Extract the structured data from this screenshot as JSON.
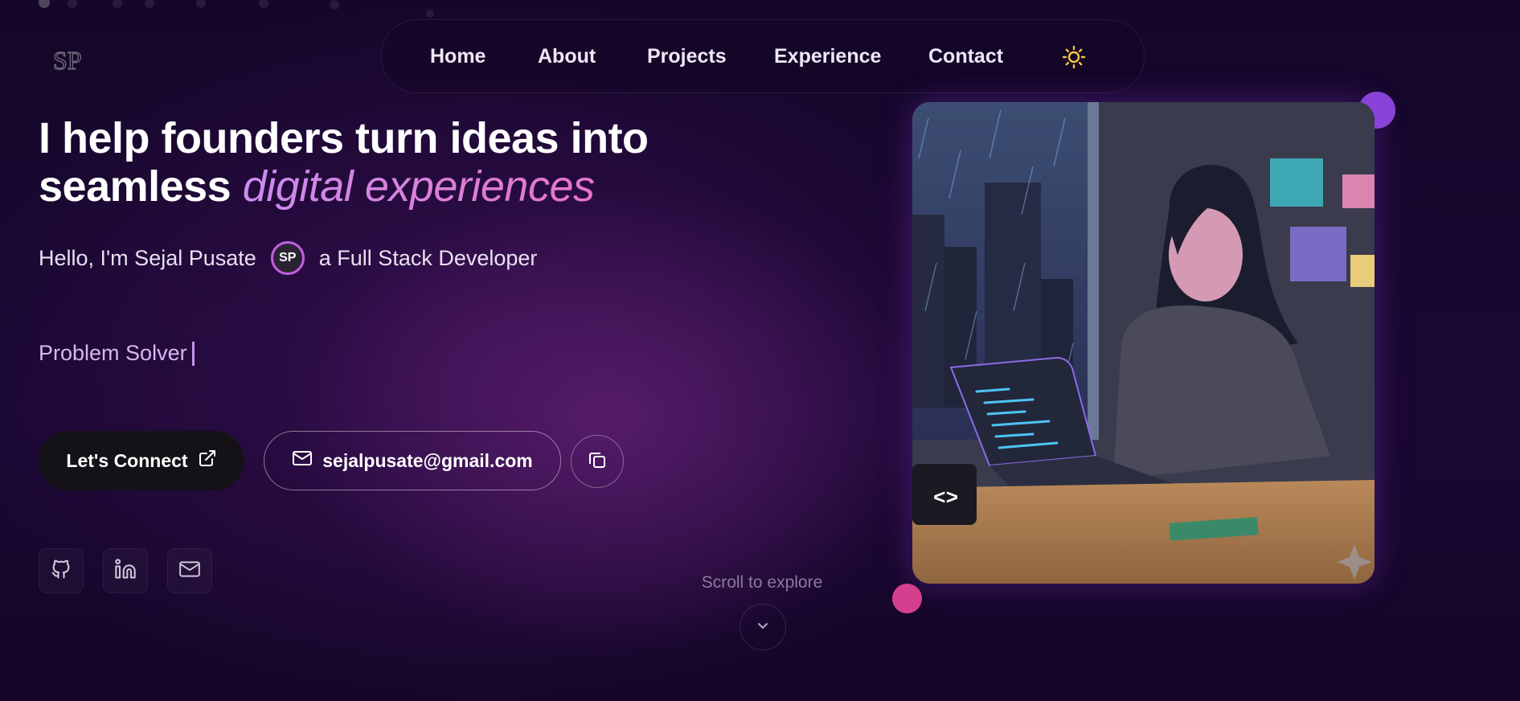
{
  "logo": {
    "text": "SP"
  },
  "nav": {
    "items": [
      "Home",
      "About",
      "Projects",
      "Experience",
      "Contact"
    ],
    "theme_toggle_icon": "sun-icon"
  },
  "hero": {
    "headline_line1": "I help founders turn ideas into",
    "headline_line2_plain": "seamless",
    "headline_line2_accent": "digital experiences",
    "intro_prefix": "Hello, I'm Sejal Pusate",
    "avatar_initials": "SP",
    "intro_suffix": "a Full Stack Developer",
    "typing_text": "Problem Solver",
    "connect_label": "Let's Connect",
    "connect_icon": "external-link-icon",
    "email_label": "sejalpusate@gmail.com",
    "email_icon": "mail-icon",
    "copy_icon": "copy-icon"
  },
  "social": [
    "github-icon",
    "linkedin-icon",
    "mail-icon"
  ],
  "scroll": {
    "label": "Scroll to explore",
    "icon": "chevron-down-icon"
  },
  "colors": {
    "background": "#1a0833",
    "accent_purple": "#c98df0",
    "accent_pink": "#e874c8",
    "sun_yellow": "#f5c542",
    "bubble_purple": "#8a44d8",
    "bubble_pink": "#d43f8e"
  }
}
